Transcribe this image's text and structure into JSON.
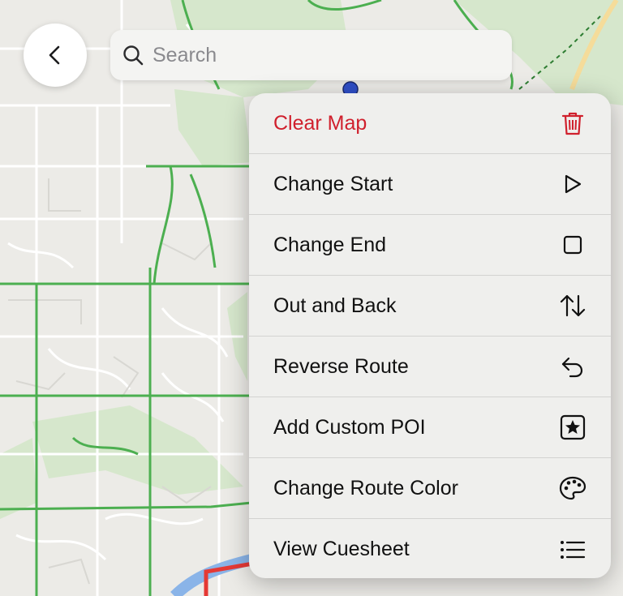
{
  "search": {
    "placeholder": "Search"
  },
  "menu": {
    "items": [
      {
        "label": "Clear Map",
        "icon": "trash-icon",
        "style": "destructive"
      },
      {
        "label": "Change Start",
        "icon": "play-icon"
      },
      {
        "label": "Change End",
        "icon": "stop-icon"
      },
      {
        "label": "Out and Back",
        "icon": "arrows-up-down-icon"
      },
      {
        "label": "Reverse Route",
        "icon": "uturn-left-icon"
      },
      {
        "label": "Add Custom POI",
        "icon": "star-square-icon"
      },
      {
        "label": "Change Route Color",
        "icon": "palette-icon"
      },
      {
        "label": "View Cuesheet",
        "icon": "list-icon"
      }
    ]
  },
  "colors": {
    "destructive": "#d0202d",
    "map_background": "#ecebe7",
    "trail_green": "#4caf50",
    "route_red": "#e53935",
    "river_blue": "#8ab4e8",
    "marker_blue": "#2f4fc7"
  }
}
